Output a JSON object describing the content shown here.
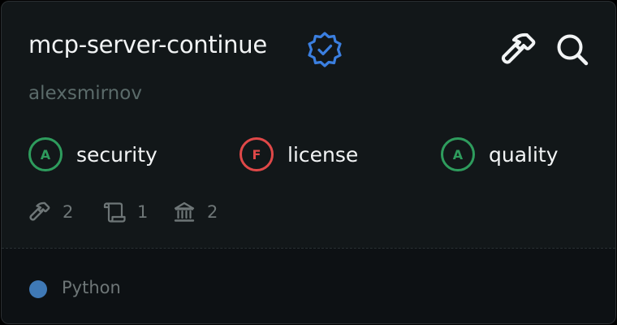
{
  "server": {
    "name": "mcp-server-continue",
    "author": "alexsmirnov",
    "verified_icon": "verified-badge-icon"
  },
  "actions": {
    "tools_icon": "hammer-icon",
    "search_icon": "search-icon"
  },
  "scores": [
    {
      "grade": "A",
      "label": "security",
      "status": "good"
    },
    {
      "grade": "F",
      "label": "license",
      "status": "bad"
    },
    {
      "grade": "A",
      "label": "quality",
      "status": "good"
    }
  ],
  "stats": [
    {
      "icon": "hammer-icon",
      "value": "2"
    },
    {
      "icon": "scroll-icon",
      "value": "1"
    },
    {
      "icon": "bank-icon",
      "value": "2"
    }
  ],
  "language": {
    "name": "Python",
    "color": "#3f79b6"
  },
  "colors": {
    "good": "#2e9c5d",
    "bad": "#e04848",
    "verified": "#3b7fe0"
  }
}
